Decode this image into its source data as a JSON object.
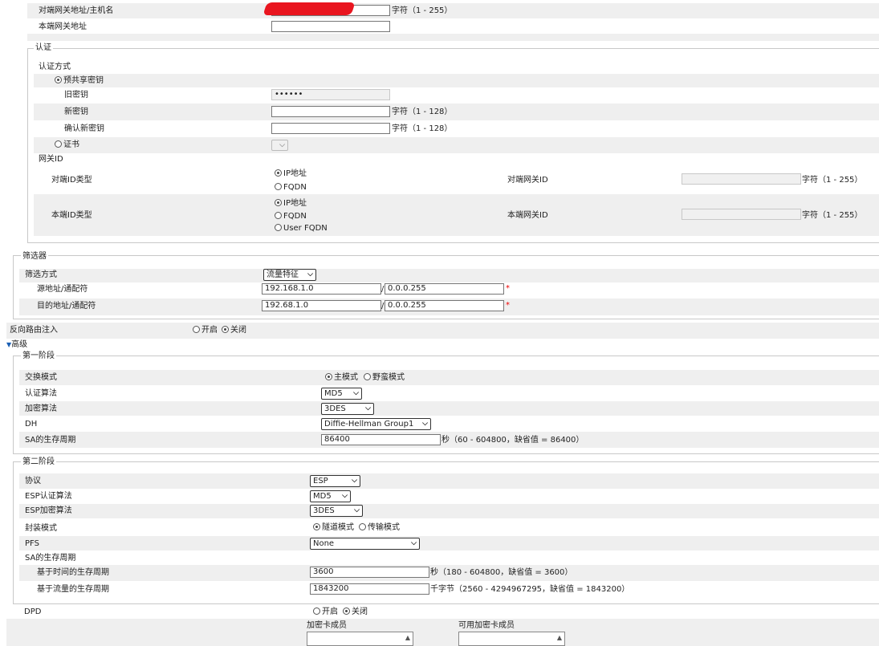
{
  "gateway": {
    "remote_addr_label": "对端网关地址/主机名",
    "remote_addr_value": "",
    "remote_addr_hint": "字符（1 - 255）",
    "local_addr_label": "本端网关地址",
    "local_addr_value": ""
  },
  "auth": {
    "legend": "认证",
    "method_label": "认证方式",
    "psk_label": "预共享密钥",
    "old_key_label": "旧密钥",
    "old_key_value": "••••••",
    "new_key_label": "新密钥",
    "new_key_hint": "字符（1 - 128）",
    "confirm_key_label": "确认新密钥",
    "confirm_key_hint": "字符（1 - 128）",
    "cert_label": "证书",
    "gateway_id_label": "网关ID",
    "remote_id_type_label": "对端ID类型",
    "remote_id_options": [
      "IP地址",
      "FQDN"
    ],
    "remote_gw_id_label": "对端网关ID",
    "remote_gw_id_hint": "字符（1 - 255）",
    "local_id_type_label": "本端ID类型",
    "local_id_options": [
      "IP地址",
      "FQDN",
      "User FQDN"
    ],
    "local_gw_id_label": "本端网关ID",
    "local_gw_id_hint": "字符（1 - 255）"
  },
  "filter": {
    "legend": "筛选器",
    "method_label": "筛选方式",
    "method_value": "流量特征",
    "src_label": "源地址/通配符",
    "src_addr": "192.168.1.0",
    "src_wildcard": "0.0.0.255",
    "dst_label": "目的地址/通配符",
    "dst_addr": "192.68.1.0",
    "dst_wildcard": "0.0.0.255",
    "slash": "/",
    "required_mark": "*"
  },
  "reverse_route": {
    "label": "反向路由注入",
    "on_label": "开启",
    "off_label": "关闭"
  },
  "advanced": {
    "label": "高级"
  },
  "phase1": {
    "legend": "第一阶段",
    "exchange_mode_label": "交换模式",
    "main_mode_label": "主模式",
    "aggressive_mode_label": "野蛮模式",
    "auth_alg_label": "认证算法",
    "auth_alg_value": "MD5",
    "enc_alg_label": "加密算法",
    "enc_alg_value": "3DES",
    "dh_label": "DH",
    "dh_value": "Diffie-Hellman Group1",
    "sa_lifetime_label": "SA的生存周期",
    "sa_lifetime_value": "86400",
    "sa_lifetime_hint": "秒（60 - 604800，缺省值 = 86400）"
  },
  "phase2": {
    "legend": "第二阶段",
    "protocol_label": "协议",
    "protocol_value": "ESP",
    "esp_auth_label": "ESP认证算法",
    "esp_auth_value": "MD5",
    "esp_enc_label": "ESP加密算法",
    "esp_enc_value": "3DES",
    "encap_label": "封装模式",
    "tunnel_label": "隧道模式",
    "transport_label": "传输模式",
    "pfs_label": "PFS",
    "pfs_value": "None",
    "sa_lifetime_label": "SA的生存周期",
    "time_lifetime_label": "基于时间的生存周期",
    "time_lifetime_value": "3600",
    "time_lifetime_hint": "秒（180 - 604800，缺省值 = 3600）",
    "traffic_lifetime_label": "基于流量的生存周期",
    "traffic_lifetime_value": "1843200",
    "traffic_lifetime_hint": "千字节（2560 - 4294967295，缺省值 = 1843200）"
  },
  "dpd": {
    "label": "DPD",
    "on_label": "开启",
    "off_label": "关闭"
  },
  "cards": {
    "members_label": "加密卡成员",
    "available_label": "可用加密卡成员"
  }
}
